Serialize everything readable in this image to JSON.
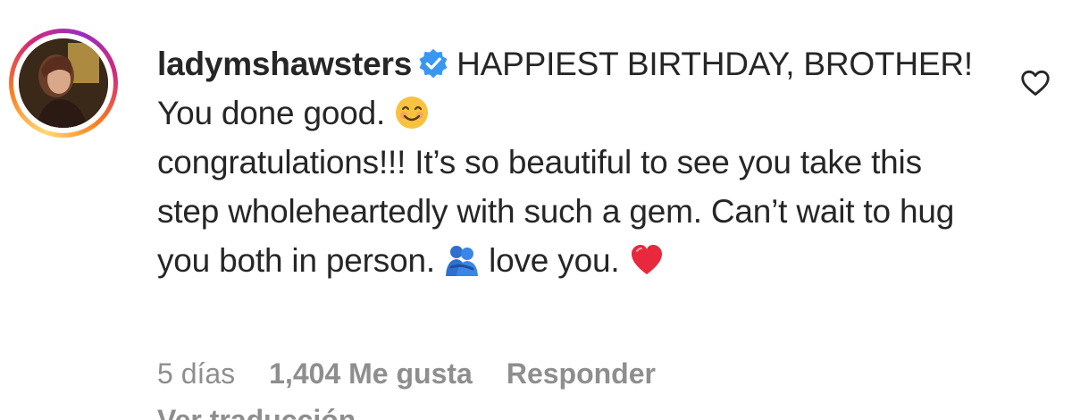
{
  "comment": {
    "username": "ladymshawsters",
    "verified": true,
    "text_part1": "HAPPIEST BIRTHDAY, BROTHER! You done good.",
    "emoji1": "smiling-face-emoji",
    "text_part2": "congratulations!!! It’s so beautiful to see you take this step wholeheartedly with such a gem. Can’t wait to hug you both in person.",
    "emoji2": "people-hugging-emoji",
    "text_part3": "love you.",
    "emoji3": "red-heart-emoji"
  },
  "meta": {
    "time": "5 días",
    "likes": "1,404 Me gusta",
    "reply": "Responder",
    "translation": "Ver traducción"
  },
  "colors": {
    "text": "#262626",
    "secondary": "#8e8e8e",
    "verified_badge": "#3897f0",
    "heart_emoji": "#e8283c"
  },
  "icons": {
    "like": "heart-outline-icon",
    "verified": "verified-badge-icon"
  }
}
